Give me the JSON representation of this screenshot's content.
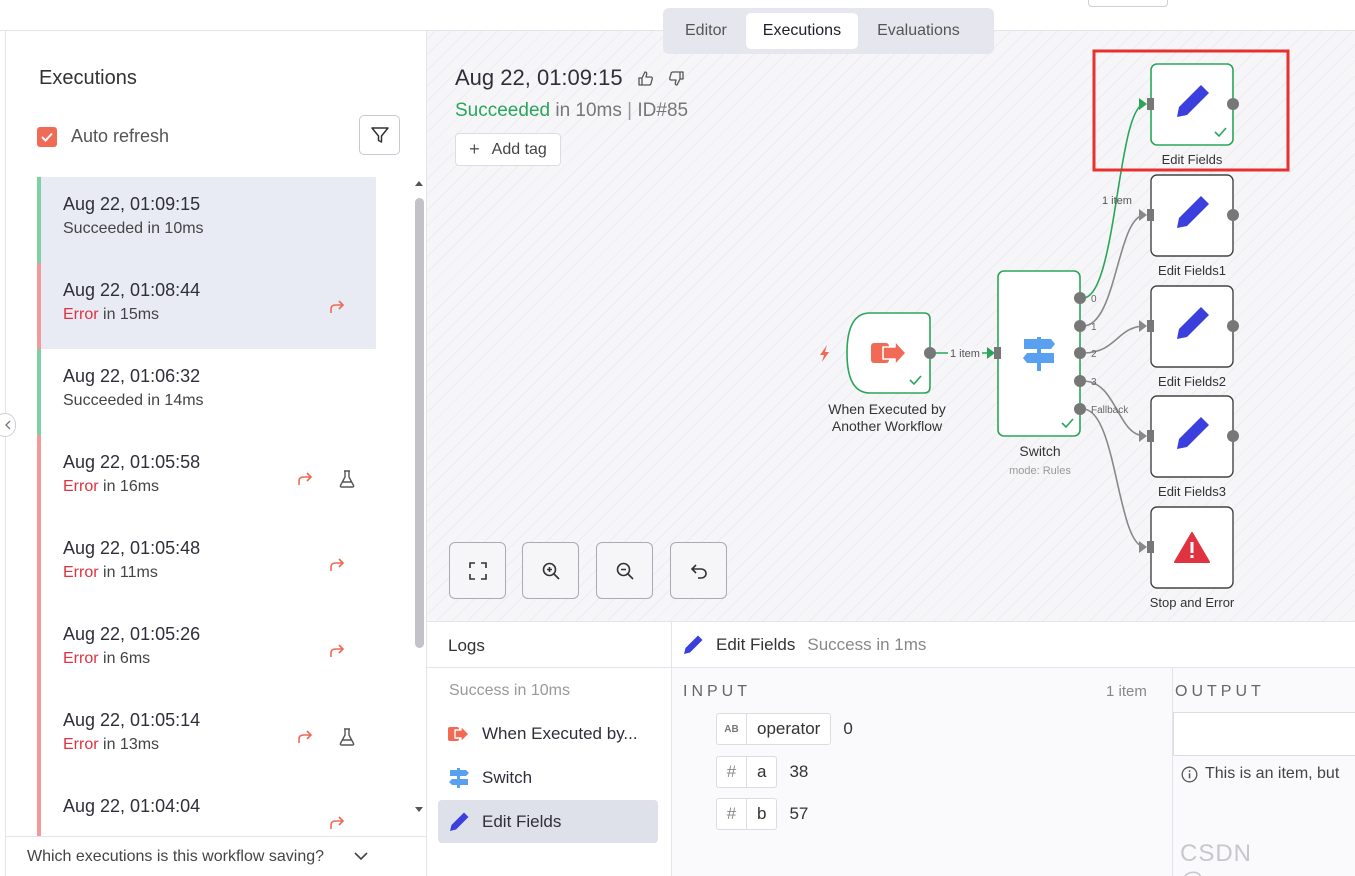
{
  "tabs": [
    "Editor",
    "Executions",
    "Evaluations"
  ],
  "sidebar": {
    "title": "Executions",
    "auto_refresh_label": "Auto refresh",
    "bottom_question": "Which executions is this workflow saving?",
    "executions": [
      {
        "date": "Aug 22, 01:09:15",
        "status_word": "Succeeded",
        "duration": "in 10ms",
        "state": "success",
        "retry": false,
        "test": false
      },
      {
        "date": "Aug 22, 01:08:44",
        "status_word": "Error",
        "duration": "in 15ms",
        "state": "error",
        "retry": true,
        "test": false
      },
      {
        "date": "Aug 22, 01:06:32",
        "status_word": "Succeeded",
        "duration": "in 14ms",
        "state": "success",
        "retry": false,
        "test": false
      },
      {
        "date": "Aug 22, 01:05:58",
        "status_word": "Error",
        "duration": "in 16ms",
        "state": "error",
        "retry": true,
        "test": true
      },
      {
        "date": "Aug 22, 01:05:48",
        "status_word": "Error",
        "duration": "in 11ms",
        "state": "error",
        "retry": true,
        "test": false
      },
      {
        "date": "Aug 22, 01:05:26",
        "status_word": "Error",
        "duration": "in 6ms",
        "state": "error",
        "retry": true,
        "test": false
      },
      {
        "date": "Aug 22, 01:05:14",
        "status_word": "Error",
        "duration": "in 13ms",
        "state": "error",
        "retry": true,
        "test": true
      },
      {
        "date": "Aug 22, 01:04:04",
        "status_word": "",
        "duration": "",
        "state": "error",
        "retry": true,
        "test": false
      }
    ]
  },
  "canvas": {
    "title": "Aug 22, 01:09:15",
    "status_word": "Succeeded",
    "status_rest": " in 10ms",
    "id_text": "ID#85",
    "add_tag_label": "Add tag",
    "nodes": {
      "trigger_line1": "When Executed by",
      "trigger_line2": "Another Workflow",
      "switch_name": "Switch",
      "switch_sub": "mode: Rules",
      "edit0": "Edit Fields",
      "edit1": "Edit Fields1",
      "edit2": "Edit Fields2",
      "edit3": "Edit Fields3",
      "stop": "Stop and Error"
    },
    "edge_labels": {
      "trigger_to_switch": "1 item",
      "switch_to_edit0": "1 item"
    },
    "output_labels": [
      "0",
      "1",
      "2",
      "3",
      "Fallback"
    ],
    "highlight_color": "#e8302f"
  },
  "logs": {
    "title": "Logs",
    "summary": "Success in 10ms",
    "items": [
      "When Executed by...",
      "Switch",
      "Edit Fields"
    ]
  },
  "node_output": {
    "node_name": "Edit Fields",
    "status": "Success in 1ms",
    "input_label": "INPUT",
    "output_label": "OUTPUT",
    "items_count": "1 item",
    "fields": [
      {
        "type": "AB",
        "name": "operator",
        "value": "0"
      },
      {
        "type": "#",
        "name": "a",
        "value": "38"
      },
      {
        "type": "#",
        "name": "b",
        "value": "57"
      }
    ],
    "output_note": "This is an item, but"
  },
  "watermark": "CSDN @speop",
  "colors": {
    "success": "#2aa55a",
    "error": "#e0323f",
    "accent": "#f06a55",
    "pencil": "#3b3fde",
    "node_border": "#2aa55a"
  }
}
